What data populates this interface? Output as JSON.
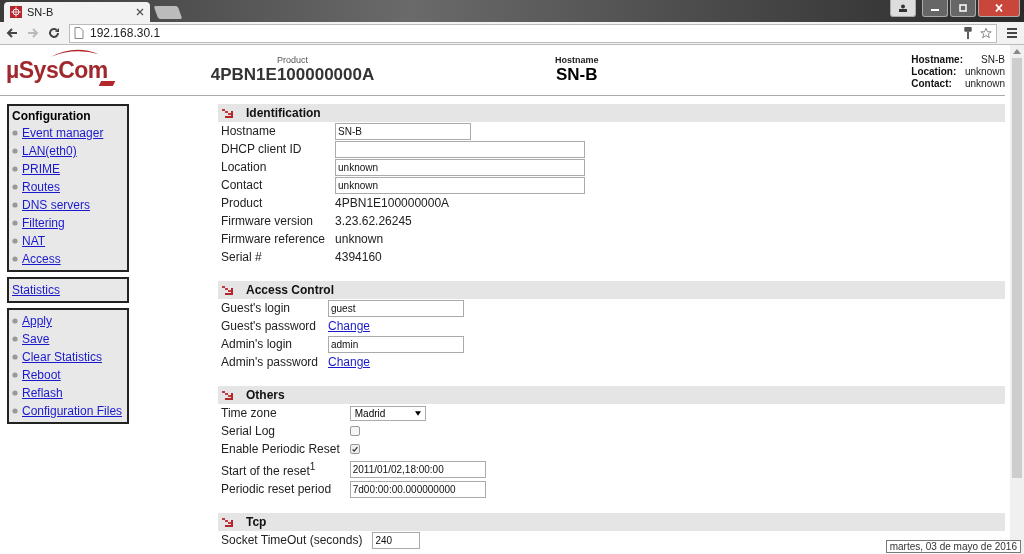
{
  "browser": {
    "tab_title": "SN-B",
    "url": "192.168.30.1"
  },
  "header": {
    "logo": "µSysCom",
    "product_label": "Product",
    "product": "4PBN1E100000000A",
    "hostname_label": "Hostname",
    "hostname": "SN-B",
    "info": [
      {
        "label": "Hostname:",
        "value": "SN-B"
      },
      {
        "label": "Location:",
        "value": "unknown"
      },
      {
        "label": "Contact:",
        "value": "unknown"
      }
    ]
  },
  "sidebar": [
    {
      "title": "Configuration",
      "bulleted": true,
      "links": [
        "Event manager",
        "LAN(eth0)",
        "PRIME",
        "Routes",
        "DNS servers",
        "Filtering",
        "NAT",
        "Access"
      ]
    },
    {
      "bulleted": false,
      "links": [
        "Statistics"
      ]
    },
    {
      "bulleted": true,
      "links": [
        "Apply",
        "Save",
        "Clear Statistics",
        "Reboot",
        "Reflash",
        "Configuration Files"
      ]
    }
  ],
  "sections": [
    {
      "title": "Identification",
      "rows": [
        {
          "kind": "field",
          "label": "Hostname",
          "value": "SN-B",
          "wide": false
        },
        {
          "kind": "field",
          "label": "DHCP client ID",
          "wide": true
        },
        {
          "kind": "field",
          "label": "Location",
          "value": "unknown",
          "wide": true
        },
        {
          "kind": "field",
          "label": "Contact",
          "value": "unknown",
          "wide": true
        },
        {
          "kind": "text",
          "label": "Product",
          "value": "4PBN1E100000000A"
        },
        {
          "kind": "text",
          "label": "Firmware version",
          "value": "3.23.62.26245"
        },
        {
          "kind": "text",
          "label": "Firmware reference",
          "value": "unknown"
        },
        {
          "kind": "text",
          "label": "Serial #",
          "value": "4394160"
        }
      ]
    },
    {
      "title": "Access Control",
      "rows": [
        {
          "kind": "field",
          "label": "Guest's login",
          "value": "guest",
          "wide": false
        },
        {
          "kind": "link",
          "label": "Guest's password",
          "value": "Change"
        },
        {
          "kind": "field",
          "label": "Admin's login",
          "value": "admin",
          "wide": false
        },
        {
          "kind": "link",
          "label": "Admin's password",
          "value": "Change"
        }
      ]
    },
    {
      "title": "Others",
      "rows": [
        {
          "kind": "select",
          "label": "Time zone",
          "value": "Madrid"
        },
        {
          "kind": "checkbox",
          "label": "Serial Log",
          "checked": false
        },
        {
          "kind": "checkbox",
          "label": "Enable Periodic Reset",
          "checked": true
        },
        {
          "kind": "field",
          "label": "Start of the reset$^{1}$",
          "value": "2011/01/02,18:00:00",
          "wide": false
        },
        {
          "kind": "field",
          "label": "Periodic reset period",
          "value": "7d00:00:00.000000000",
          "wide": false
        }
      ]
    },
    {
      "title": "Tcp",
      "rows": [
        {
          "kind": "field",
          "label": "Socket TimeOut (seconds)",
          "value": "240",
          "tiny": true
        }
      ]
    }
  ],
  "tooltip": "martes, 03 de mayo de 2016"
}
